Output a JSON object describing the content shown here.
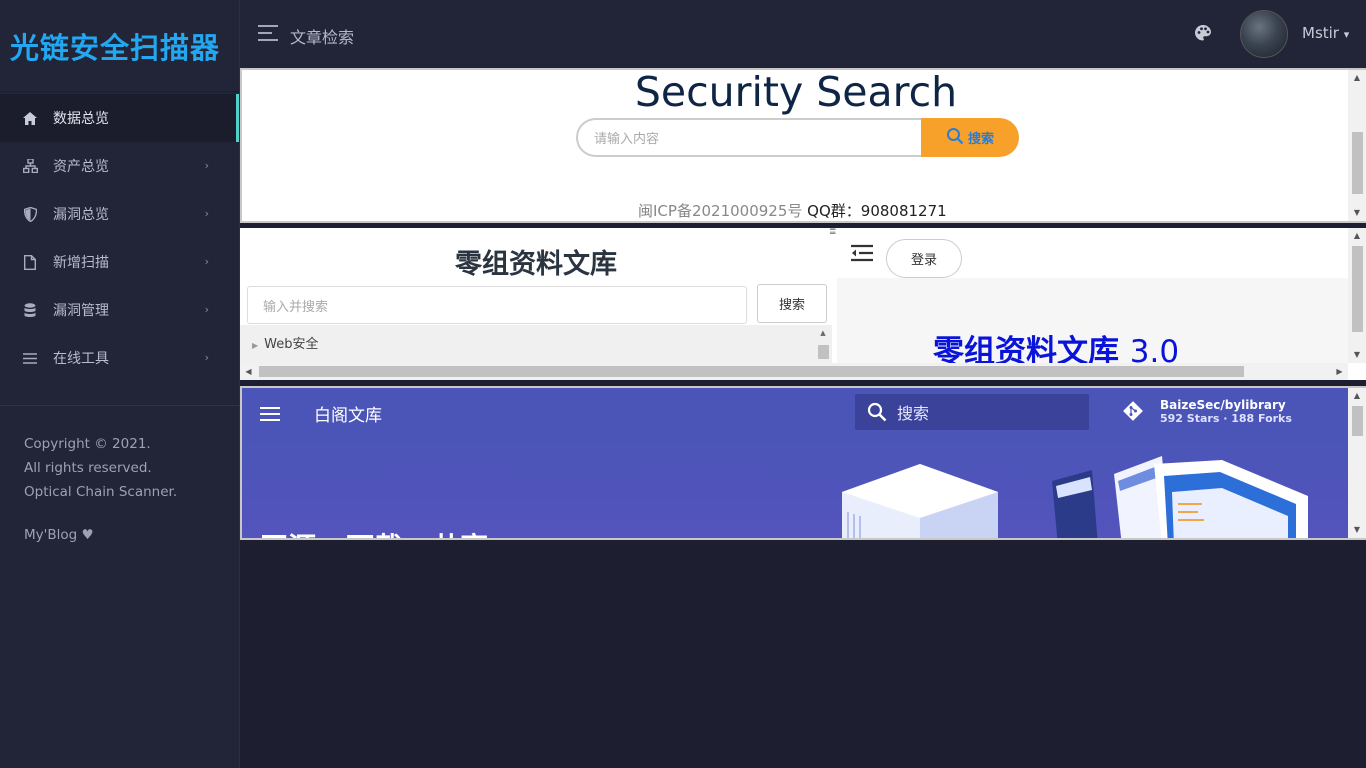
{
  "app": {
    "logo": "光链安全扫描器"
  },
  "sidebar": {
    "items": [
      {
        "label": "数据总览",
        "icon": "home-icon",
        "active": true
      },
      {
        "label": "资产总览",
        "icon": "sitemap-icon"
      },
      {
        "label": "漏洞总览",
        "icon": "shield-icon"
      },
      {
        "label": "新增扫描",
        "icon": "file-icon"
      },
      {
        "label": "漏洞管理",
        "icon": "database-icon"
      },
      {
        "label": "在线工具",
        "icon": "list-icon"
      }
    ],
    "footer": {
      "line1": "Copyright © 2021.",
      "line2": "All rights reserved.",
      "line3": "Optical Chain Scanner.",
      "blog": "My'Blog ♥"
    }
  },
  "header": {
    "title": "文章检索",
    "username": "Mstir",
    "user_caret": "▾"
  },
  "panel1": {
    "title": "Security Search",
    "search_placeholder": "请输入内容",
    "search_button": "搜索",
    "icp": "闽ICP备2021000925号",
    "qq": "QQ群：908081271"
  },
  "panel2": {
    "title": "零组资料文库",
    "search_placeholder": "输入并搜索",
    "search_button": "搜索",
    "tree_item": "Web安全",
    "login_button": "登录",
    "big_title": "零组资料文库",
    "version": "3.0"
  },
  "panel3": {
    "title": "白阁文库",
    "search_placeholder": "搜索",
    "repo_name": "BaizeSec/bylibrary",
    "repo_stats": "592 Stars · 188 Forks",
    "hero_text": "开源 · 下载 · 共享"
  },
  "colors": {
    "accent": "#4fd0c8",
    "logo": "#23a7f0",
    "search_button": "#f7a12b",
    "baige_header": "#4b55b7"
  }
}
